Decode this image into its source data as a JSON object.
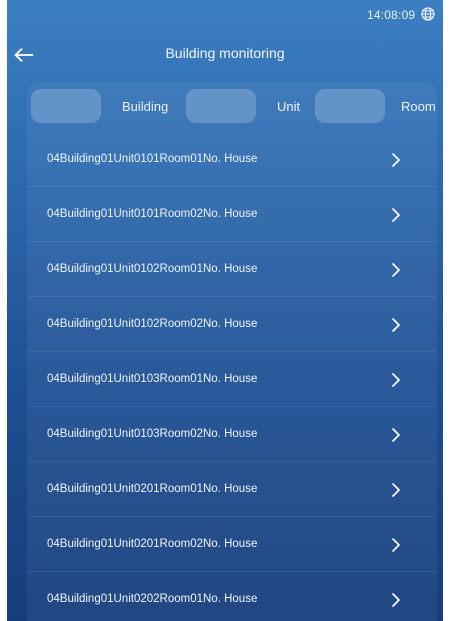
{
  "status_bar": {
    "time": "14:08:09",
    "language_icon": "globe-icon"
  },
  "header": {
    "back_icon": "arrow-left-icon",
    "title": "Building monitoring"
  },
  "filters": {
    "building_label": "Building",
    "unit_label": "Unit",
    "room_label": "Room"
  },
  "houses": [
    {
      "label": "04Building01Unit0101Room01No. House"
    },
    {
      "label": "04Building01Unit0101Room02No. House"
    },
    {
      "label": "04Building01Unit0102Room01No. House"
    },
    {
      "label": "04Building01Unit0102Room02No. House"
    },
    {
      "label": "04Building01Unit0103Room01No. House"
    },
    {
      "label": "04Building01Unit0103Room02No. House"
    },
    {
      "label": "04Building01Unit0201Room01No. House"
    },
    {
      "label": "04Building01Unit0201Room02No. House"
    },
    {
      "label": "04Building01Unit0202Room01No. House"
    }
  ],
  "colors": {
    "background_top": "#3c7fc2",
    "background_bottom": "#163d7b",
    "text": "#ffffff"
  }
}
